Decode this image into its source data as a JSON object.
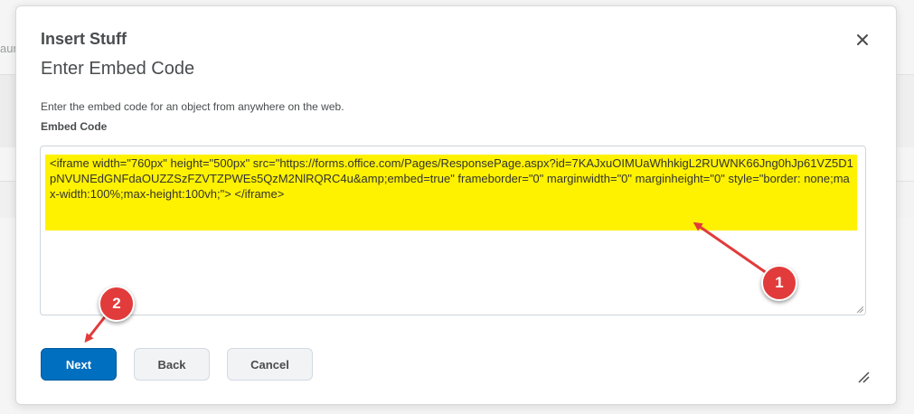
{
  "background": {
    "partial_text": "aur"
  },
  "dialog": {
    "title": "Insert Stuff",
    "subtitle": "Enter Embed Code",
    "description": "Enter the embed code for an object from anywhere on the web.",
    "field_label": "Embed Code",
    "embed_code_value": "<iframe width=\"760px\" height=\"500px\" src=\"https://forms.office.com/Pages/ResponsePage.aspx?id=7KAJxuOIMUaWhhkigL2RUWNK66Jng0hJp61VZ5D1pNVUNEdGNFdaOUZZSzFZVTZPWEs5QzM2NlRQRC4u&amp;embed=true\" frameborder=\"0\" marginwidth=\"0\" marginheight=\"0\" style=\"border: none;max-width:100%;max-height:100vh;\"> </iframe>",
    "close_icon": "close-icon",
    "buttons": {
      "next": "Next",
      "back": "Back",
      "cancel": "Cancel"
    }
  },
  "annotations": {
    "callout_1": "1",
    "callout_2": "2",
    "highlight_color": "#fff200",
    "callout_color": "#e23b3b"
  },
  "colors": {
    "primary": "#006fbf",
    "text": "#494c4e"
  }
}
